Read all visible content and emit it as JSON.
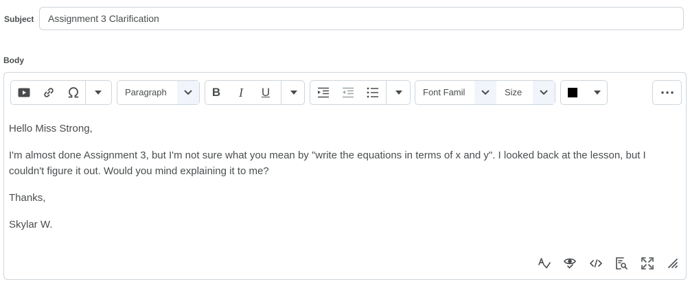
{
  "subject": {
    "label": "Subject",
    "value": "Assignment 3 Clarification"
  },
  "body": {
    "label": "Body",
    "toolbar": {
      "block_format": "Paragraph",
      "bold": "B",
      "italic": "I",
      "underline": "U",
      "font_family": "Font Famil",
      "font_size": "Size",
      "text_color": "#000000",
      "more": "..."
    },
    "content": {
      "greeting": "Hello Miss Strong,",
      "paragraph": "I'm almost done Assignment 3, but I'm not sure what you mean by \"write the equations in terms of x and y\". I looked back at the lesson, but I couldn't figure it out. Would you mind explaining it to me?",
      "closing": "Thanks,",
      "signature": "Skylar W."
    }
  }
}
